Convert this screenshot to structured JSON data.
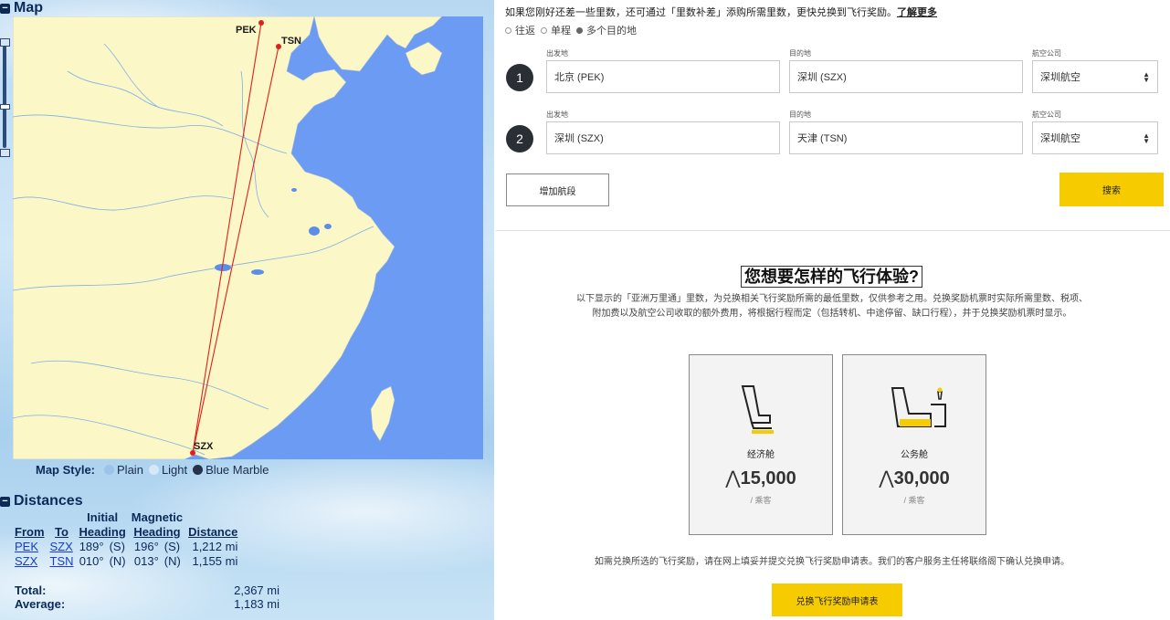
{
  "map_section": {
    "title": "Map",
    "airports": {
      "pek": "PEK",
      "tsn": "TSN",
      "szx": "SZX"
    },
    "map_style": {
      "label": "Map Style:",
      "options": [
        "Plain",
        "Light",
        "Blue Marble"
      ]
    }
  },
  "distances_section": {
    "title": "Distances",
    "headers": {
      "from": "From",
      "to": "To",
      "initial_top": "Initial",
      "initial_bottom": "Heading",
      "magnetic_top": "Magnetic",
      "magnetic_bottom": "Heading",
      "distance": "Distance"
    },
    "rows": [
      {
        "from": "PEK",
        "to": "SZX",
        "initial": "189°",
        "initial_dir": "(S)",
        "magnetic": "196°",
        "magnetic_dir": "(S)",
        "distance": "1,212 mi"
      },
      {
        "from": "SZX",
        "to": "TSN",
        "initial": "010°",
        "initial_dir": "(N)",
        "magnetic": "013°",
        "magnetic_dir": "(N)",
        "distance": "1,155 mi"
      }
    ],
    "total_label": "Total:",
    "total_value": "2,367 mi",
    "average_label": "Average:",
    "average_value": "1,183 mi"
  },
  "booking": {
    "intro_text": "如果您刚好还差一些里数，还可通过「里数补差」添购所需里数，更快兑换到飞行奖励。",
    "learn_more": "了解更多",
    "trip_types": [
      "往返",
      "单程",
      "多个目的地"
    ],
    "selected_trip_type": "多个目的地",
    "segments": [
      {
        "number": "1",
        "origin_label": "出发地",
        "origin": "北京 (PEK)",
        "dest_label": "目的地",
        "dest": "深圳 (SZX)",
        "airline_label": "航空公司",
        "airline": "深圳航空"
      },
      {
        "number": "2",
        "origin_label": "出发地",
        "origin": "深圳 (SZX)",
        "dest_label": "目的地",
        "dest": "天津 (TSN)",
        "airline_label": "航空公司",
        "airline": "深圳航空"
      }
    ],
    "add_segment": "增加航段",
    "search": "搜索"
  },
  "experience": {
    "heading": "您想要怎样的飞行体验?",
    "desc_line1": "以下显示的「亚洲万里通」里数，为兑换相关飞行奖励所需的最低里数，仅供参考之用。兑换奖励机票时实际所需里数、税项、",
    "desc_line2": "附加费以及航空公司收取的额外费用，将根据行程而定（包括转机、中途停留、缺口行程），并于兑换奖励机票时显示。",
    "cards": [
      {
        "cabin": "经济舱",
        "miles": "15,000",
        "per": "/ 乘客",
        "icon": "economy-seat-icon"
      },
      {
        "cabin": "公务舱",
        "miles": "30,000",
        "per": "/ 乘客",
        "icon": "business-seat-icon"
      }
    ],
    "footer_text": "如需兑换所选的飞行奖励，请在网上填妥并提交兑换飞行奖励申请表。我们的客户服务主任将联络阁下确认兑换申请。",
    "apply_button": "兑换飞行奖励申请表"
  },
  "colors": {
    "ocean": "#6b9bf2",
    "land": "#fbf7c6",
    "route": "#e0201c",
    "accent_yellow": "#f6cc00"
  }
}
